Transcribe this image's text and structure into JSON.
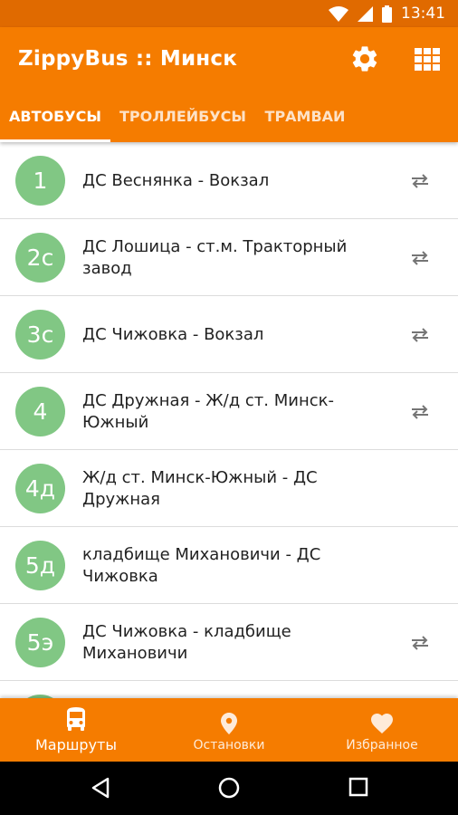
{
  "status_bar": {
    "time": "13:41"
  },
  "app_bar": {
    "title": "ZippyBus :: Минск"
  },
  "tabs": [
    {
      "label": "АВТОБУСЫ",
      "active": true
    },
    {
      "label": "ТРОЛЛЕЙБУСЫ",
      "active": false
    },
    {
      "label": "ТРАМВАИ",
      "active": false
    }
  ],
  "routes": [
    {
      "number": "1",
      "name_line1": "ДС Веснянка - Вокзал",
      "name_line2": "",
      "swap": true
    },
    {
      "number": "2с",
      "name_line1": "ДС Лошица - ст.м. Тракторный",
      "name_line2": "завод",
      "swap": true
    },
    {
      "number": "3с",
      "name_line1": "ДС Чижовка - Вокзал",
      "name_line2": "",
      "swap": true
    },
    {
      "number": "4",
      "name_line1": "ДС Дружная - Ж/д ст. Минск-",
      "name_line2": "Южный",
      "swap": true
    },
    {
      "number": "4д",
      "name_line1": "Ж/д ст. Минск-Южный - ДС",
      "name_line2": "Дружная",
      "swap": false
    },
    {
      "number": "5д",
      "name_line1": "кладбище Михановичи - ДС",
      "name_line2": "Чижовка",
      "swap": false
    },
    {
      "number": "5э",
      "name_line1": "ДС Чижовка - кладбище",
      "name_line2": "Михановичи",
      "swap": true
    }
  ],
  "bottom_nav": [
    {
      "label": "Маршруты",
      "icon": "bus-icon",
      "active": true
    },
    {
      "label": "Остановки",
      "icon": "map-pin-icon",
      "active": false
    },
    {
      "label": "Избранное",
      "icon": "heart-icon",
      "active": false
    }
  ],
  "colors": {
    "primary": "#f57c00",
    "status_bar": "#e06a00",
    "route_badge": "#81c784"
  }
}
